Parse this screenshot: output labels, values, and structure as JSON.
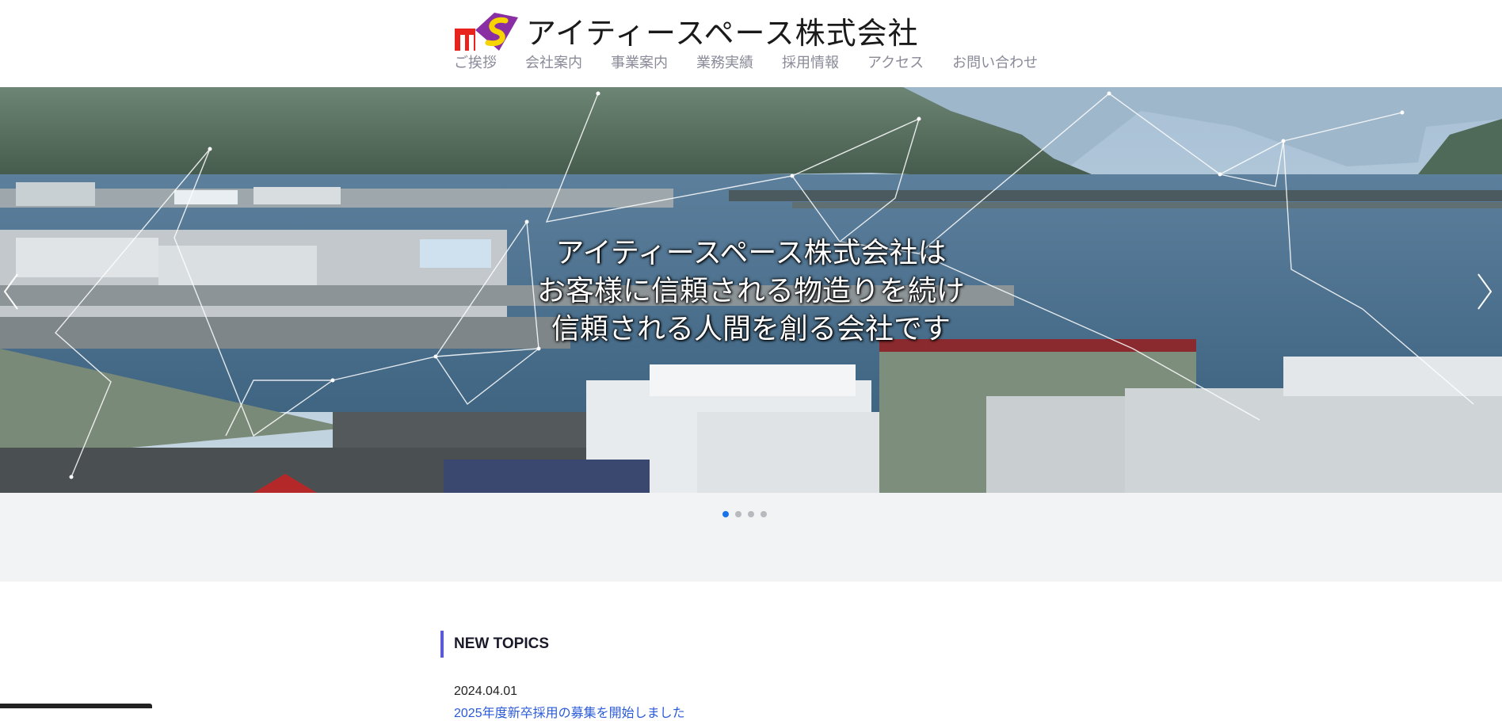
{
  "header": {
    "company_name": "アイティースペース株式会社",
    "logo_text": "ITS"
  },
  "nav": {
    "items": [
      "ご挨拶",
      "会社案内",
      "事業案内",
      "業務実績",
      "採用情報",
      "アクセス",
      "お問い合わせ"
    ]
  },
  "hero": {
    "lines": [
      "アイティースペース株式会社は",
      "お客様に信頼される物造りを続け",
      "信頼される人間を創る会社です"
    ],
    "slide_count": 4,
    "active_slide": 1
  },
  "topics": {
    "title": "NEW TOPICS",
    "items": [
      {
        "date": "2024.04.01",
        "text": "2025年度新卒採用の募集を開始しました"
      }
    ]
  },
  "colors": {
    "accent": "#5a5ad8",
    "active_dot": "#1a73e8",
    "nav_text": "#8a8a98",
    "band": "#f2f3f5"
  }
}
